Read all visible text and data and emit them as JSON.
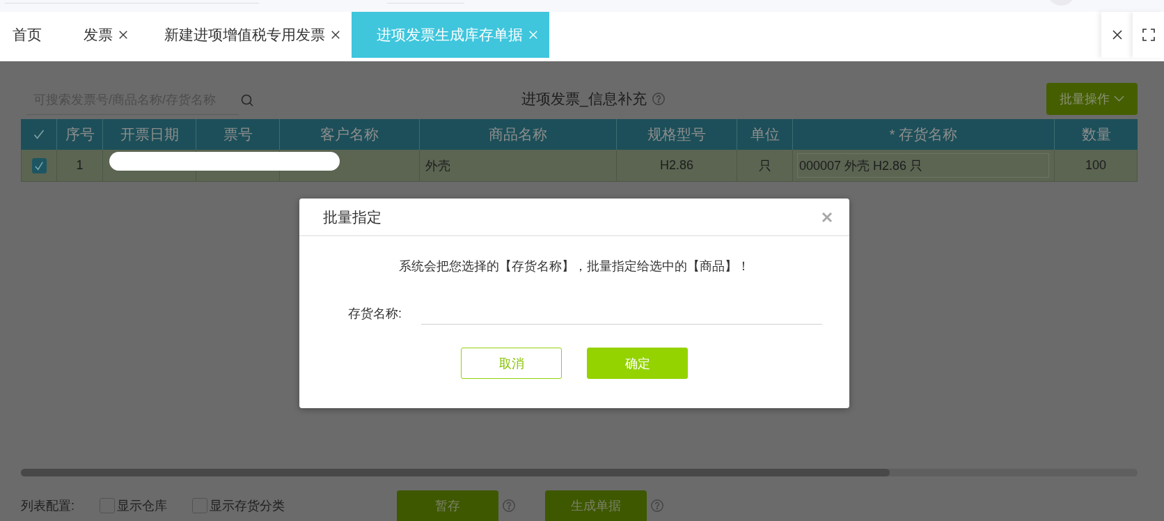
{
  "tabs": [
    {
      "label": "首页",
      "closable": false,
      "selected": false
    },
    {
      "label": "发票",
      "closable": true,
      "selected": false
    },
    {
      "label": "新建进项增值税专用发票",
      "closable": true,
      "selected": false
    },
    {
      "label": "进项发票生成库存单据",
      "closable": true,
      "selected": true
    }
  ],
  "toolbar": {
    "search": {
      "placeholder": "可搜索发票号/商品名称/存货名称"
    },
    "title": "进项发票_信息补充",
    "batch_button": "批量操作"
  },
  "table": {
    "select_all_checked": true,
    "columns": [
      "序号",
      "开票日期",
      "票号",
      "客户名称",
      "商品名称",
      "规格型号",
      "单位",
      "* 存货名称",
      "数量"
    ],
    "rows": [
      {
        "selected": true,
        "redacted": true,
        "cells": [
          {
            "kind": "center",
            "text": "1"
          },
          {
            "kind": "blank"
          },
          {
            "kind": "blank"
          },
          {
            "kind": "blank"
          },
          {
            "kind": "left",
            "text": "外壳"
          },
          {
            "kind": "center",
            "text": "H2.86"
          },
          {
            "kind": "center",
            "text": "只"
          },
          {
            "kind": "field",
            "text": "000007 外壳 H2.86 只"
          },
          {
            "kind": "center",
            "text": "100"
          }
        ]
      }
    ]
  },
  "footer": {
    "config_label": "列表配置:",
    "options": [
      {
        "label": "显示仓库",
        "checked": false
      },
      {
        "label": "显示存货分类",
        "checked": false
      }
    ],
    "buttons": [
      "暂存",
      "生成单据"
    ]
  },
  "dialog": {
    "title": "批量指定",
    "message": "系统会把您选择的【存货名称】，批量指定给选中的【商品】！",
    "field_label": "存货名称:",
    "buttons": [
      {
        "label": "取消",
        "kind": "secondary"
      },
      {
        "label": "确定",
        "kind": "primary"
      }
    ]
  }
}
